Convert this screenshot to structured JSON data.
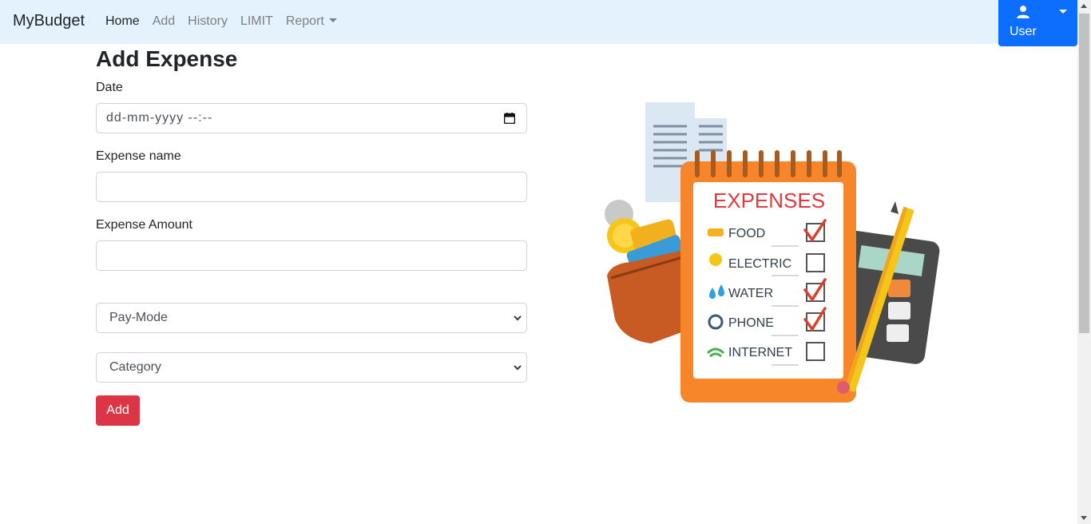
{
  "navbar": {
    "brand": "MyBudget",
    "links": [
      {
        "label": "Home",
        "active": true
      },
      {
        "label": "Add",
        "active": false
      },
      {
        "label": "History",
        "active": false
      },
      {
        "label": "LIMIT",
        "active": false
      },
      {
        "label": "Report",
        "active": false,
        "dropdown": true
      }
    ],
    "user_label": "User"
  },
  "form": {
    "title": "Add Expense",
    "date_label": "Date",
    "date_placeholder": "dd-mm-yyyy --:--",
    "name_label": "Expense name",
    "name_value": "",
    "amount_label": "Expense Amount",
    "amount_value": "",
    "paymode_selected": "Pay-Mode",
    "category_selected": "Category",
    "add_label": "Add"
  },
  "illustration": {
    "heading": "EXPENSES",
    "items": [
      {
        "label": "FOOD",
        "checked": true
      },
      {
        "label": "ELECTRIC",
        "checked": false
      },
      {
        "label": "WATER",
        "checked": true
      },
      {
        "label": "PHONE",
        "checked": true
      },
      {
        "label": "INTERNET",
        "checked": false
      }
    ]
  },
  "colors": {
    "navbar_bg": "#e3f2fd",
    "primary": "#0d6efd",
    "danger": "#dc3545",
    "notebook_orange": "#f7862a",
    "heading_red": "#e0393e"
  }
}
